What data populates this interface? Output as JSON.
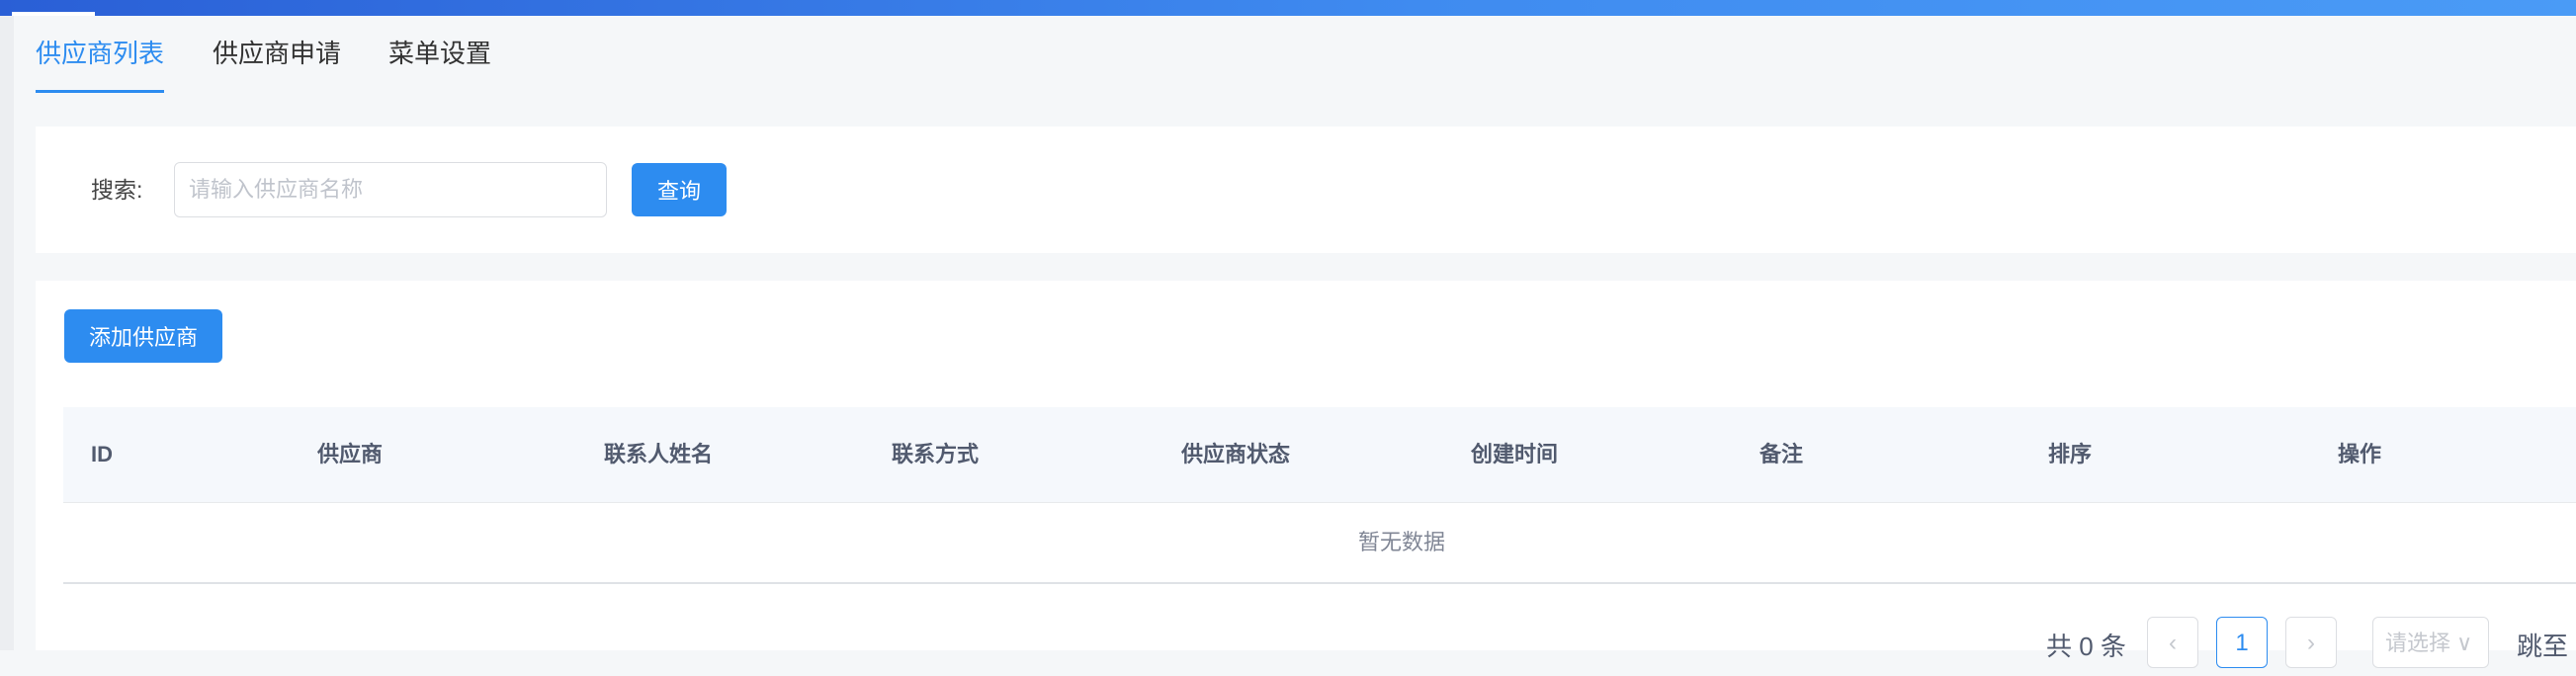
{
  "tabs": [
    {
      "label": "供应商列表",
      "active": true
    },
    {
      "label": "供应商申请",
      "active": false
    },
    {
      "label": "菜单设置",
      "active": false
    }
  ],
  "search": {
    "label": "搜索:",
    "placeholder": "请输入供应商名称",
    "query_button": "查询"
  },
  "toolbar": {
    "add_button": "添加供应商"
  },
  "table": {
    "columns": [
      "ID",
      "供应商",
      "联系人姓名",
      "联系方式",
      "供应商状态",
      "创建时间",
      "备注",
      "排序",
      "操作"
    ],
    "empty_text": "暂无数据"
  },
  "pagination": {
    "total_text": "共 0 条",
    "prev": "‹",
    "current_page": "1",
    "next": "›",
    "page_size_placeholder": "请选择 ∨",
    "jump_label": "跳至"
  },
  "colors": {
    "accent": "#2d8cf0",
    "header_gradient_start": "#2a5fd6",
    "header_gradient_end": "#4a9bf6"
  }
}
